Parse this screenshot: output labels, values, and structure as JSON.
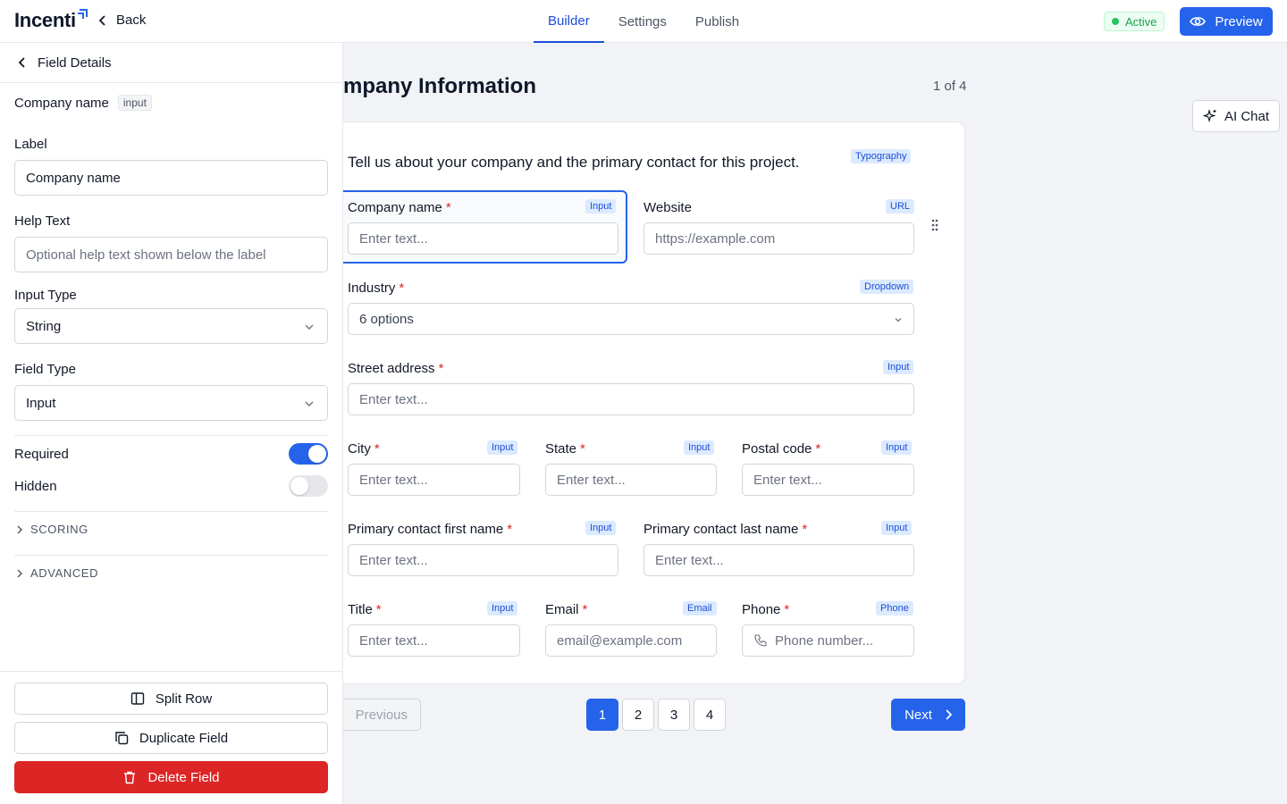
{
  "header": {
    "logo": "Incenti",
    "back_label": "Back",
    "tabs": [
      {
        "label": "Builder",
        "active": true
      },
      {
        "label": "Settings",
        "active": false
      },
      {
        "label": "Publish",
        "active": false
      }
    ],
    "status": "Active",
    "preview_label": "Preview",
    "accent": "#2563eb"
  },
  "sidebar": {
    "back_title": "Field Details",
    "field_name": "Company name",
    "field_kind": "input",
    "label_label": "Label",
    "label_value": "Company name",
    "help_label": "Help Text",
    "help_placeholder": "Optional help text shown below the label",
    "input_type_label": "Input Type",
    "input_type_value": "String",
    "field_type_label": "Field Type",
    "field_type_value": "Input",
    "required_label": "Required",
    "required": true,
    "hidden_label": "Hidden",
    "hidden": false,
    "scoring_label": "SCORING",
    "advanced_label": "ADVANCED",
    "split_label": "Split Row",
    "duplicate_label": "Duplicate Field",
    "delete_label": "Delete Field"
  },
  "canvas": {
    "title": "Company Information",
    "page_count": "1 of 4",
    "ai_chat_label": "AI Chat",
    "intro": "Tell us about your company and the primary contact for this project.",
    "intro_badge": "Typography",
    "fields": {
      "company": {
        "label": "Company name",
        "badge": "Input",
        "placeholder": "Enter text..."
      },
      "website": {
        "label": "Website",
        "badge": "URL",
        "placeholder": "https://example.com"
      },
      "industry": {
        "label": "Industry",
        "badge": "Dropdown",
        "value": "6 options"
      },
      "street": {
        "label": "Street address",
        "badge": "Input",
        "placeholder": "Enter text..."
      },
      "city": {
        "label": "City",
        "badge": "Input",
        "placeholder": "Enter text..."
      },
      "state": {
        "label": "State",
        "badge": "Input",
        "placeholder": "Enter text..."
      },
      "postal": {
        "label": "Postal code",
        "badge": "Input",
        "placeholder": "Enter text..."
      },
      "first": {
        "label": "Primary contact first name",
        "badge": "Input",
        "placeholder": "Enter text..."
      },
      "last": {
        "label": "Primary contact last name",
        "badge": "Input",
        "placeholder": "Enter text..."
      },
      "title": {
        "label": "Title",
        "badge": "Input",
        "placeholder": "Enter text..."
      },
      "email": {
        "label": "Email",
        "badge": "Email",
        "placeholder": "email@example.com"
      },
      "phone": {
        "label": "Phone",
        "badge": "Phone",
        "placeholder": "Phone number..."
      }
    },
    "pager": {
      "previous": "Previous",
      "pages": [
        "1",
        "2",
        "3",
        "4"
      ],
      "next": "Next"
    }
  }
}
